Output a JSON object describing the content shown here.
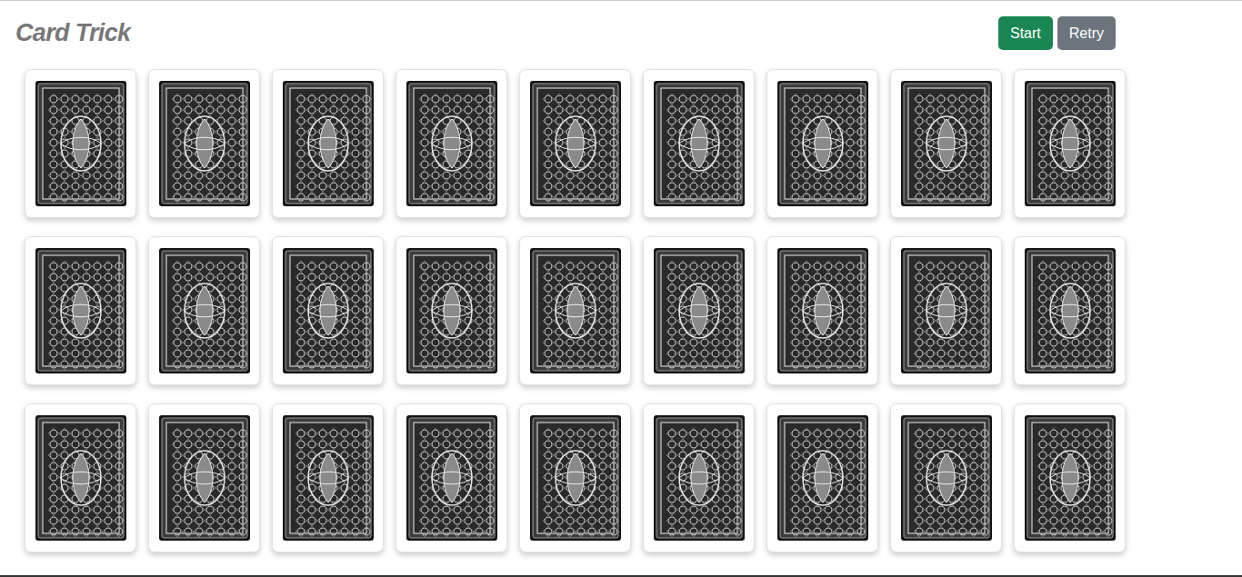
{
  "title": "Card Trick",
  "buttons": [
    {
      "label": "Start",
      "color": "#198754"
    },
    {
      "label": "Retry",
      "color": "#6c757d"
    }
  ],
  "cards": [
    {
      "face_down": true
    },
    {
      "face_down": true
    },
    {
      "face_down": true
    },
    {
      "face_down": true
    },
    {
      "face_down": true
    },
    {
      "face_down": true
    },
    {
      "face_down": true
    },
    {
      "face_down": true
    },
    {
      "face_down": true
    },
    {
      "face_down": true
    },
    {
      "face_down": true
    },
    {
      "face_down": true
    },
    {
      "face_down": true
    },
    {
      "face_down": true
    },
    {
      "face_down": true
    },
    {
      "face_down": true
    },
    {
      "face_down": true
    },
    {
      "face_down": true
    },
    {
      "face_down": true
    },
    {
      "face_down": true
    },
    {
      "face_down": true
    },
    {
      "face_down": true
    },
    {
      "face_down": true
    },
    {
      "face_down": true
    },
    {
      "face_down": true
    },
    {
      "face_down": true
    },
    {
      "face_down": true
    }
  ]
}
